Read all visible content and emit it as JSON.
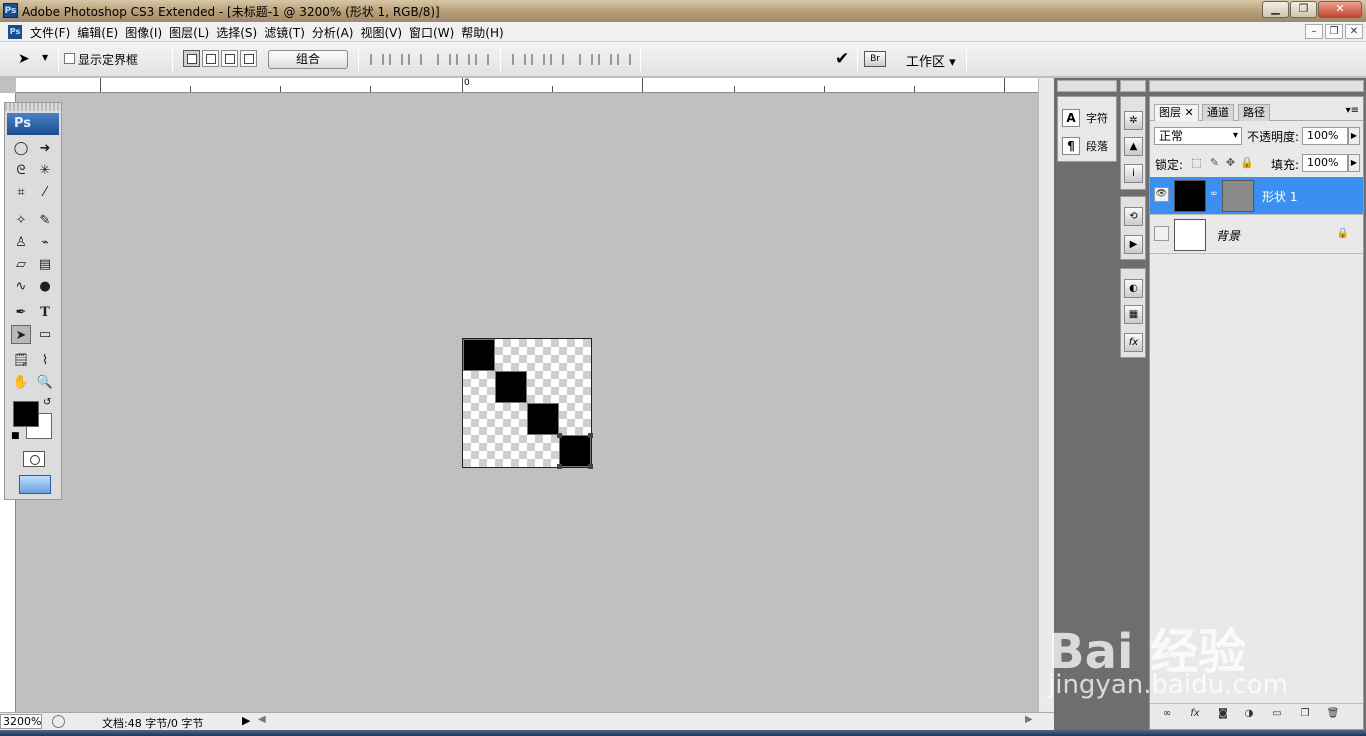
{
  "window": {
    "logo_text": "Ps",
    "title": "Adobe Photoshop CS3 Extended - [未标题-1 @ 3200% (形状 1, RGB/8)]",
    "min_label": "▁",
    "max_label": "❐",
    "close_label": "✕"
  },
  "menubar": {
    "items": [
      "文件(F)",
      "编辑(E)",
      "图像(I)",
      "图层(L)",
      "选择(S)",
      "滤镜(T)",
      "分析(A)",
      "视图(V)",
      "窗口(W)",
      "帮助(H)"
    ]
  },
  "options": {
    "show_bounding_box": "显示定界框",
    "combine_label": "组合",
    "workspace_label": "工作区 ▾",
    "commit_glyph": "✔"
  },
  "ruler": {
    "zero_label": "0"
  },
  "status": {
    "zoom": "3200%",
    "doc_info": "文档:48 字节/0 字节"
  },
  "toolbox": {
    "badge": "Ps"
  },
  "mini_panel": {
    "character_label": "字符",
    "paragraph_label": "段落"
  },
  "layers_panel": {
    "tabs": [
      "图层 ✕",
      "通道",
      "路径"
    ],
    "blend_mode": "正常",
    "opacity_label": "不透明度:",
    "opacity_value": "100%",
    "lock_label": "锁定:",
    "fill_label": "填充:",
    "fill_value": "100%",
    "layers": [
      {
        "name": "形状 1",
        "selected": true,
        "visible": true
      },
      {
        "name": "背景",
        "selected": false,
        "visible": false,
        "locked": true
      }
    ]
  },
  "watermark": {
    "main": "Bai 经验",
    "sub": "jingyan.baidu.com"
  }
}
